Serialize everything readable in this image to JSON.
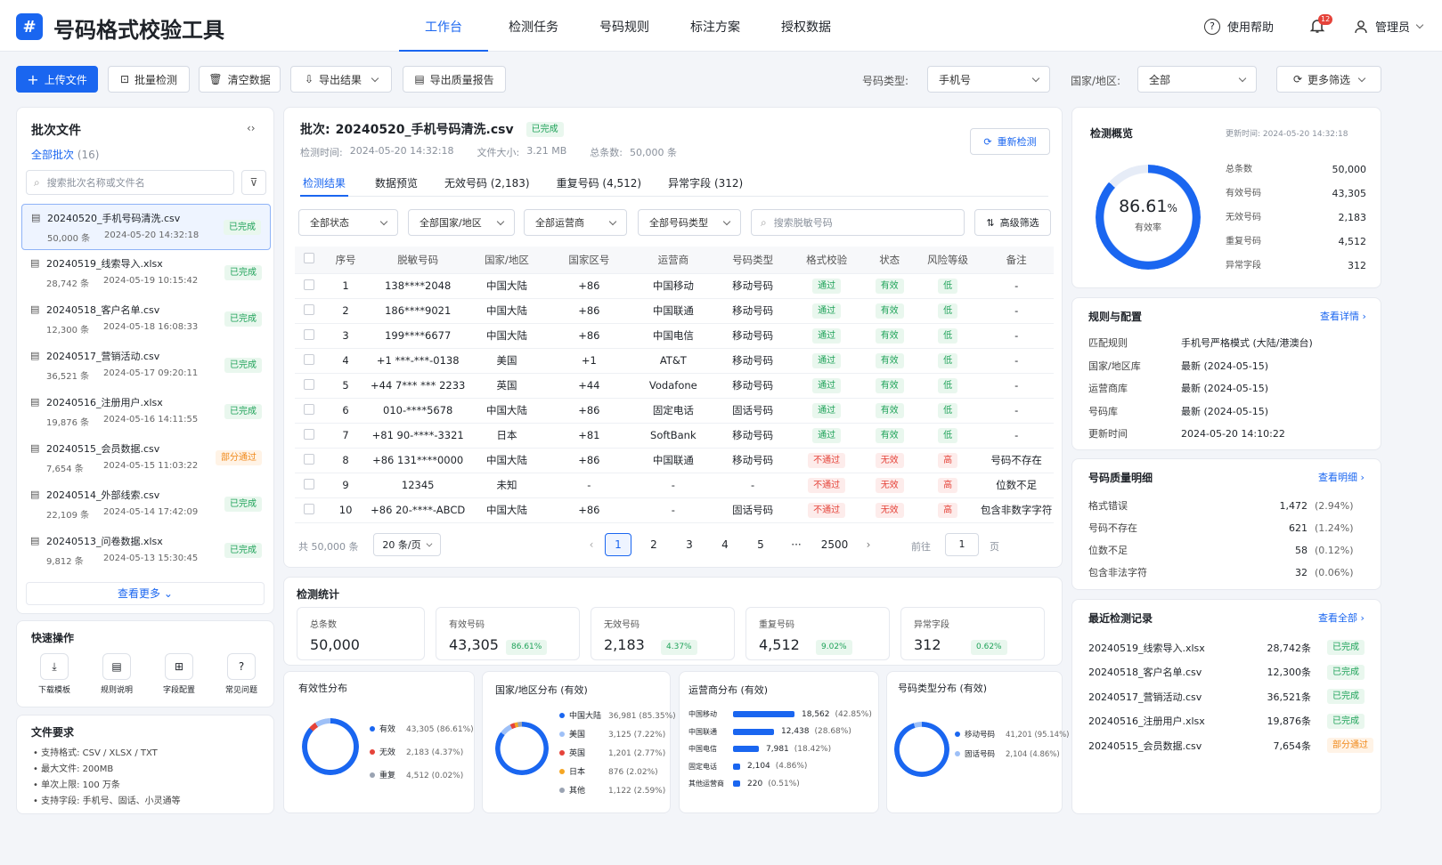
{
  "app": {
    "title": "号码格式校验工具",
    "logo": "#"
  },
  "nav": {
    "items": [
      "工作台",
      "检测任务",
      "号码规则",
      "标注方案",
      "授权数据"
    ],
    "active": 0
  },
  "header": {
    "help": "使用帮助",
    "badge": "12",
    "user": "管理员"
  },
  "toolbar": {
    "upload": "上传文件",
    "batch": "批量检测",
    "clear": "清空数据",
    "export": "导出结果",
    "report": "导出质量报告",
    "type_label": "号码类型:",
    "type_value": "手机号",
    "region_label": "国家/地区:",
    "region_value": "全部",
    "more": "更多筛选"
  },
  "sidebar": {
    "title": "批次文件",
    "all": "全部批次",
    "count": "(16)",
    "search_ph": "搜索批次名称或文件名",
    "more": "查看更多",
    "files": [
      {
        "name": "20240520_手机号码清洗.csv",
        "count": "50,000 条",
        "time": "2024-05-20 14:32:18",
        "status": "已完成",
        "st": "green"
      },
      {
        "name": "20240519_线索导入.xlsx",
        "count": "28,742 条",
        "time": "2024-05-19 10:15:42",
        "status": "已完成",
        "st": "green"
      },
      {
        "name": "20240518_客户名单.csv",
        "count": "12,300 条",
        "time": "2024-05-18 16:08:33",
        "status": "已完成",
        "st": "green"
      },
      {
        "name": "20240517_营销活动.csv",
        "count": "36,521 条",
        "time": "2024-05-17 09:20:11",
        "status": "已完成",
        "st": "green"
      },
      {
        "name": "20240516_注册用户.xlsx",
        "count": "19,876 条",
        "time": "2024-05-16 14:11:55",
        "status": "已完成",
        "st": "green"
      },
      {
        "name": "20240515_会员数据.csv",
        "count": "7,654 条",
        "time": "2024-05-15 11:03:22",
        "status": "部分通过",
        "st": "orange"
      },
      {
        "name": "20240514_外部线索.csv",
        "count": "22,109 条",
        "time": "2024-05-14 17:42:09",
        "status": "已完成",
        "st": "green"
      },
      {
        "name": "20240513_问卷数据.xlsx",
        "count": "9,812 条",
        "time": "2024-05-13 15:30:45",
        "status": "已完成",
        "st": "green"
      }
    ]
  },
  "quick": {
    "title": "快速操作",
    "items": [
      "下载模板",
      "规则说明",
      "字段配置",
      "常见问题"
    ]
  },
  "req": {
    "title": "文件要求",
    "items": [
      "支持格式: CSV / XLSX / TXT",
      "最大文件: 200MB",
      "单次上限: 100 万条",
      "支持字段: 手机号、固话、小灵通等"
    ]
  },
  "batch": {
    "label": "批次:",
    "name": "20240520_手机号码清洗.csv",
    "status": "已完成",
    "time_label": "检测时间:",
    "time": "2024-05-20 14:32:18",
    "size_label": "文件大小:",
    "size": "3.21 MB",
    "total_label": "总条数:",
    "total": "50,000 条",
    "recheck": "重新检测"
  },
  "tabs": [
    "检测结果",
    "数据预览",
    "无效号码 (2,183)",
    "重复号码 (4,512)",
    "异常字段 (312)"
  ],
  "filters": {
    "status": "全部状态",
    "region": "全部国家/地区",
    "carrier": "全部运营商",
    "type": "全部号码类型",
    "search_ph": "搜索脱敏号码",
    "adv": "高级筛选"
  },
  "table": {
    "headers": [
      "序号",
      "脱敏号码",
      "国家/地区",
      "国家区号",
      "运营商",
      "号码类型",
      "格式校验",
      "状态",
      "风险等级",
      "备注"
    ],
    "rows": [
      [
        "1",
        "138****2048",
        "中国大陆",
        "+86",
        "中国移动",
        "移动号码",
        "通过",
        "有效",
        "低",
        "-"
      ],
      [
        "2",
        "186****9021",
        "中国大陆",
        "+86",
        "中国联通",
        "移动号码",
        "通过",
        "有效",
        "低",
        "-"
      ],
      [
        "3",
        "199****6677",
        "中国大陆",
        "+86",
        "中国电信",
        "移动号码",
        "通过",
        "有效",
        "低",
        "-"
      ],
      [
        "4",
        "+1 ***-***-0138",
        "美国",
        "+1",
        "AT&T",
        "移动号码",
        "通过",
        "有效",
        "低",
        "-"
      ],
      [
        "5",
        "+44 7*** *** 2233",
        "英国",
        "+44",
        "Vodafone",
        "移动号码",
        "通过",
        "有效",
        "低",
        "-"
      ],
      [
        "6",
        "010-****5678",
        "中国大陆",
        "+86",
        "固定电话",
        "固话号码",
        "通过",
        "有效",
        "低",
        "-"
      ],
      [
        "7",
        "+81 90-****-3321",
        "日本",
        "+81",
        "SoftBank",
        "移动号码",
        "通过",
        "有效",
        "低",
        "-"
      ],
      [
        "8",
        "+86 131****0000",
        "中国大陆",
        "+86",
        "中国联通",
        "移动号码",
        "不通过",
        "无效",
        "高",
        "号码不存在"
      ],
      [
        "9",
        "12345",
        "未知",
        "-",
        "-",
        "-",
        "不通过",
        "无效",
        "高",
        "位数不足"
      ],
      [
        "10",
        "+86 20-****-ABCD",
        "中国大陆",
        "+86",
        "-",
        "固话号码",
        "不通过",
        "无效",
        "高",
        "包含非数字字符"
      ]
    ]
  },
  "pager": {
    "total": "共 50,000 条",
    "size": "20 条/页",
    "pages": [
      "1",
      "2",
      "3",
      "4",
      "5",
      "···",
      "2500"
    ],
    "goto": "前往",
    "page": "1",
    "unit": "页"
  },
  "stats": {
    "title": "检测统计",
    "cards": [
      {
        "label": "总条数",
        "value": "50,000",
        "pct": ""
      },
      {
        "label": "有效号码",
        "value": "43,305",
        "pct": "86.61%"
      },
      {
        "label": "无效号码",
        "value": "2,183",
        "pct": "4.37%"
      },
      {
        "label": "重复号码",
        "value": "4,512",
        "pct": "9.02%"
      },
      {
        "label": "异常字段",
        "value": "312",
        "pct": "0.62%"
      }
    ]
  },
  "chart_validity": {
    "title": "有效性分布",
    "items": [
      {
        "name": "有效",
        "value": "43,305 (86.61%)",
        "color": "#1a66f0"
      },
      {
        "name": "无效",
        "value": "2,183 (4.37%)",
        "color": "#e5433a"
      },
      {
        "name": "重复",
        "value": "4,512 (0.02%)",
        "color": "#9aa3b2"
      }
    ]
  },
  "chart_region": {
    "title": "国家/地区分布 (有效)",
    "items": [
      {
        "name": "中国大陆",
        "value": "36,981 (85.35%)",
        "color": "#1a66f0"
      },
      {
        "name": "美国",
        "value": "3,125 (7.22%)",
        "color": "#9ec0f7"
      },
      {
        "name": "英国",
        "value": "1,201 (2.77%)",
        "color": "#e5433a"
      },
      {
        "name": "日本",
        "value": "876 (2.02%)",
        "color": "#f5a623"
      },
      {
        "name": "其他",
        "value": "1,122 (2.59%)",
        "color": "#9aa3b2"
      }
    ]
  },
  "chart_carrier": {
    "title": "运营商分布 (有效)",
    "items": [
      {
        "name": "中国移动",
        "value": "18,562",
        "pct": "(42.85%)",
        "frac": 0.4285
      },
      {
        "name": "中国联通",
        "value": "12,438",
        "pct": "(28.68%)",
        "frac": 0.2868
      },
      {
        "name": "中国电信",
        "value": "7,981",
        "pct": "(18.42%)",
        "frac": 0.1842
      },
      {
        "name": "固定电话",
        "value": "2,104",
        "pct": "(4.86%)",
        "frac": 0.0486
      },
      {
        "name": "其他运营商",
        "value": "220",
        "pct": "(0.51%)",
        "frac": 0.0051
      }
    ]
  },
  "chart_type": {
    "title": "号码类型分布 (有效)",
    "items": [
      {
        "name": "移动号码",
        "value": "41,201 (95.14%)",
        "color": "#1a66f0"
      },
      {
        "name": "固话号码",
        "value": "2,104 (4.86%)",
        "color": "#9ec0f7"
      }
    ]
  },
  "overview": {
    "title": "检测概览",
    "updated_label": "更新时间:",
    "updated": "2024-05-20 14:32:18",
    "rate": "86.61",
    "rate_unit": "%",
    "rate_label": "有效率",
    "rate_frac": 0.8661,
    "rows": [
      {
        "k": "总条数",
        "v": "50,000"
      },
      {
        "k": "有效号码",
        "v": "43,305"
      },
      {
        "k": "无效号码",
        "v": "2,183"
      },
      {
        "k": "重复号码",
        "v": "4,512"
      },
      {
        "k": "异常字段",
        "v": "312"
      }
    ]
  },
  "rules": {
    "title": "规则与配置",
    "link": "查看详情",
    "rows": [
      {
        "k": "匹配规则",
        "v": "手机号严格模式 (大陆/港澳台)"
      },
      {
        "k": "国家/地区库",
        "v": "最新 (2024-05-15)"
      },
      {
        "k": "运营商库",
        "v": "最新 (2024-05-15)"
      },
      {
        "k": "号码库",
        "v": "最新 (2024-05-15)"
      },
      {
        "k": "更新时间",
        "v": "2024-05-20 14:10:22"
      }
    ]
  },
  "quality": {
    "title": "号码质量明细",
    "link": "查看明细",
    "rows": [
      {
        "k": "格式错误",
        "v": "1,472",
        "p": "(2.94%)"
      },
      {
        "k": "号码不存在",
        "v": "621",
        "p": "(1.24%)"
      },
      {
        "k": "位数不足",
        "v": "58",
        "p": "(0.12%)"
      },
      {
        "k": "包含非法字符",
        "v": "32",
        "p": "(0.06%)"
      }
    ]
  },
  "recent": {
    "title": "最近检测记录",
    "link": "查看全部",
    "rows": [
      {
        "n": "20240519_线索导入.xlsx",
        "c": "28,742条",
        "s": "已完成",
        "st": "green"
      },
      {
        "n": "20240518_客户名单.csv",
        "c": "12,300条",
        "s": "已完成",
        "st": "green"
      },
      {
        "n": "20240517_营销活动.csv",
        "c": "36,521条",
        "s": "已完成",
        "st": "green"
      },
      {
        "n": "20240516_注册用户.xlsx",
        "c": "19,876条",
        "s": "已完成",
        "st": "green"
      },
      {
        "n": "20240515_会员数据.csv",
        "c": "7,654条",
        "s": "部分通过",
        "st": "orange"
      }
    ]
  }
}
